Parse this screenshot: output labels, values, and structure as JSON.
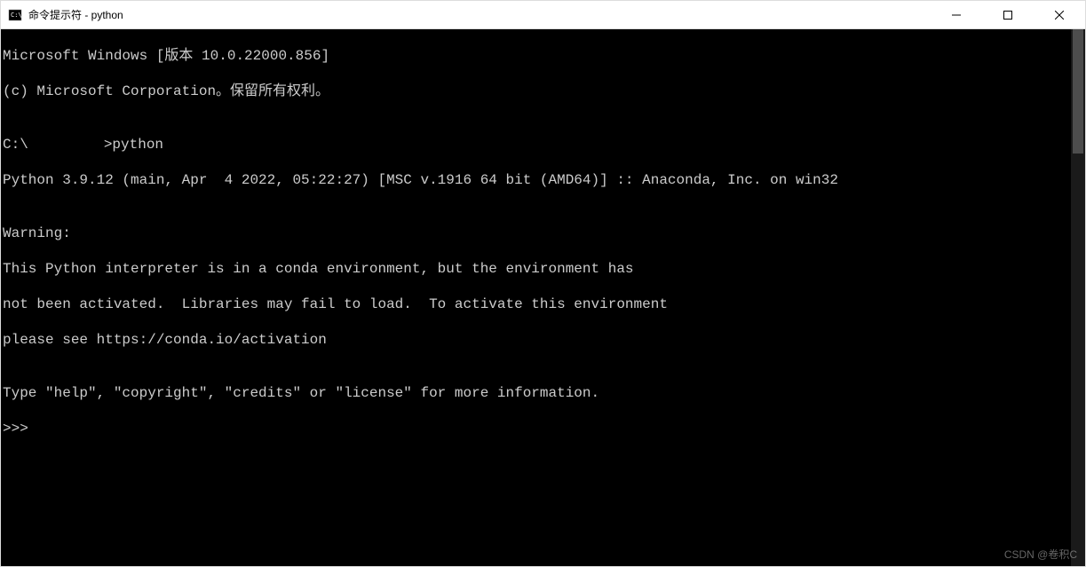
{
  "window": {
    "title": "命令提示符 - python"
  },
  "terminal": {
    "line1": "Microsoft Windows [版本 10.0.22000.856]",
    "line2": "(c) Microsoft Corporation。保留所有权利。",
    "blank1": "",
    "prompt_prefix": "C:\\",
    "prompt_suffix": ">python",
    "python_version": "Python 3.9.12 (main, Apr  4 2022, 05:22:27) [MSC v.1916 64 bit (AMD64)] :: Anaconda, Inc. on win32",
    "blank2": "",
    "warning_header": "Warning:",
    "warning_l1": "This Python interpreter is in a conda environment, but the environment has",
    "warning_l2": "not been activated.  Libraries may fail to load.  To activate this environment",
    "warning_l3": "please see https://conda.io/activation",
    "blank3": "",
    "help_line": "Type \"help\", \"copyright\", \"credits\" or \"license\" for more information.",
    "repl_prompt": ">>> "
  },
  "watermark": "CSDN @卷积C"
}
